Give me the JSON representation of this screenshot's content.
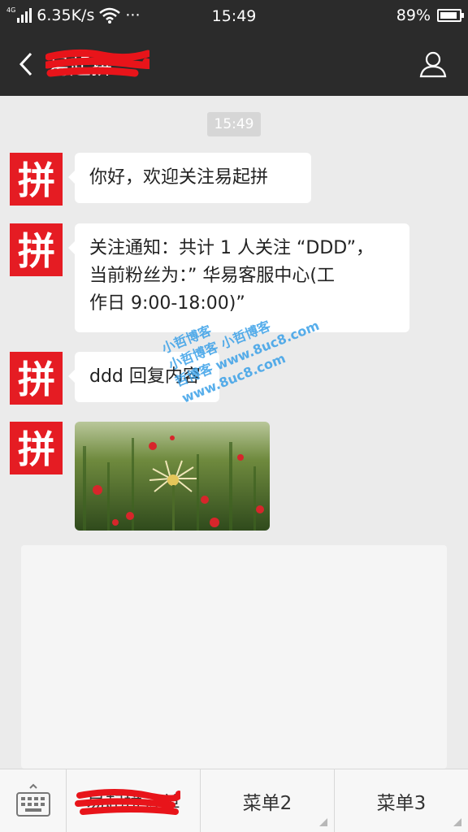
{
  "status": {
    "signal_tag": "4G",
    "net_speed": "6.35K/s",
    "more": "···",
    "time": "15:49",
    "battery": "89%",
    "battery_level": 0.89
  },
  "header": {
    "title": "易起拼",
    "back_icon": "chevron-left-icon",
    "profile_icon": "user-icon"
  },
  "chat": {
    "timestamp": "15:49",
    "messages": [
      {
        "type": "text",
        "lines": [
          "你好，欢迎关注易起拼"
        ]
      },
      {
        "type": "text",
        "lines": [
          "关注通知：共计 1 人关注 “DDD”，",
          "当前粉丝为：” 华易客服中心(工",
          "作日 9:00-18:00)”"
        ]
      },
      {
        "type": "text",
        "lines": [
          "ddd 回复内容"
        ]
      },
      {
        "type": "image",
        "alt": "flower photo"
      }
    ],
    "avatar_glyph": "拼",
    "watermark": [
      "小哲博客",
      "小哲博客 小哲博客",
      "哲博客 www.8uc8.com",
      "www.8uc8.com"
    ]
  },
  "menu": {
    "keyboard_icon": "keyboard-icon",
    "items": [
      "易起拼订单",
      "菜单2",
      "菜单3"
    ]
  },
  "colors": {
    "bar_bg": "#2b2b2b",
    "avatar_red": "#e51c23",
    "chat_bg": "#ebebeb"
  }
}
